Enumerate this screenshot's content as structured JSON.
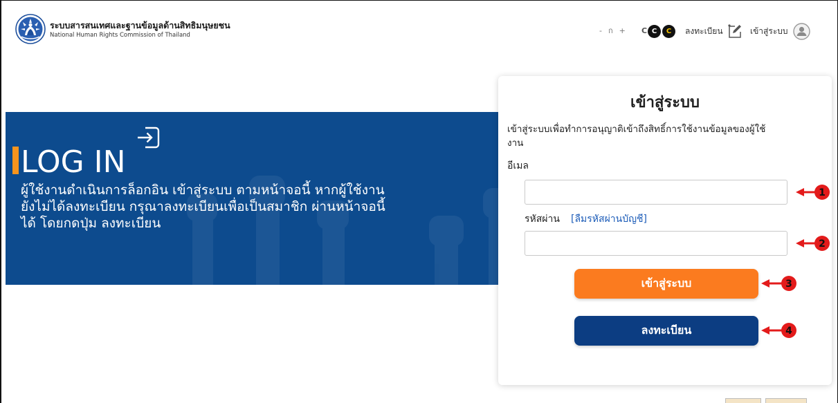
{
  "header": {
    "site_title": "ระบบสารสนเทศและฐานข้อมูลด้านสิทธิมนุษยชน",
    "site_subtitle": "National Human Rights Commission of Thailand",
    "font_size_controls": {
      "decrease": "-",
      "normal": "ก",
      "increase": "+"
    },
    "contrast_controls": {
      "default": "C",
      "dark": "C",
      "yellow": "C"
    },
    "register_link": "ลงทะเบียน",
    "login_link": "เข้าสู่ระบบ",
    "icons": {
      "logo": "nhrct-emblem-logo",
      "register": "edit-icon",
      "login": "user-icon"
    }
  },
  "banner": {
    "title": "LOG IN",
    "title_icon": "login-arrow-icon",
    "description_lines": [
      "ผู้ใช้งานดำเนินการล็อกอิน เข้าสู่ระบบ ตามหน้าจอนี้ หากผู้ใช้งาน",
      "ยังไม่ได้ลงทะเบียน กรุณาลงทะเบียนเพื่อเป็นสมาชิก ผ่านหน้าจอนี้",
      "ได้ โดยกดปุ่ม ลงทะเบียน"
    ]
  },
  "login_card": {
    "title": "เข้าสู่ระบบ",
    "description_lines": [
      "เข้าสู่ระบบเพื่อทำการอนุญาติเข้าถึงสิทธิ์การใช้งานข้อมูลของผู้ใช้",
      "งาน"
    ],
    "email_label": "อีเมล",
    "email_value": "",
    "password_label": "รหัสผ่าน",
    "forgot_password_link": "[ลืมรหัสผ่านบัญชี]",
    "password_value": "",
    "login_button": "เข้าสู่ระบบ",
    "register_button": "ลงทะเบียน"
  },
  "annotations": [
    "1",
    "2",
    "3",
    "4"
  ],
  "colors": {
    "banner_bg": "#0d4b8e",
    "accent_orange": "#f7941d",
    "login_button_bg": "#fb7b1f",
    "register_button_bg": "#0c3d82",
    "link_blue": "#1c5cb8",
    "annotation_red": "#e31b1b",
    "contrast_yellow": "#f5c400"
  }
}
